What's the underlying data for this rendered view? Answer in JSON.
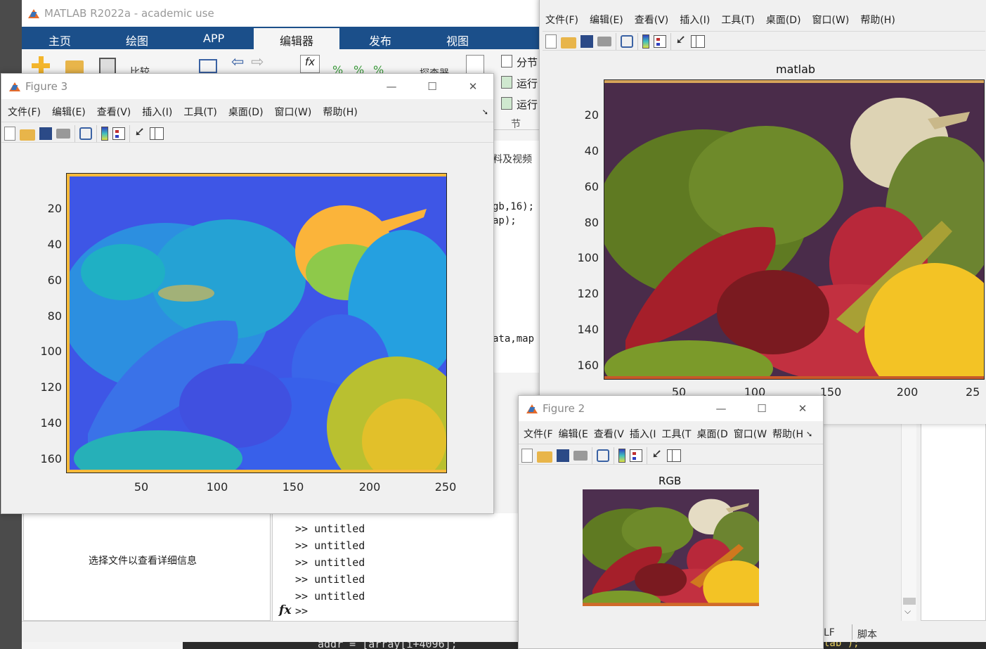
{
  "matlab": {
    "title": "MATLAB R2022a - academic use",
    "tabs": [
      "主页",
      "绘图",
      "APP",
      "编辑器",
      "发布",
      "视图"
    ],
    "active_tab": "编辑器",
    "ribbon_right": [
      "分节",
      "运行",
      "运行"
    ],
    "ribbon_section": "节",
    "ribbon_partial_1": "比较",
    "ribbon_partial_2": "探查器",
    "code_fragments": [
      "料及视频",
      "gb,16);",
      "ap);",
      "ata,map"
    ],
    "detail_panel_text": "选择文件以查看详细信息",
    "command_history": [
      ">> untitled",
      ">> untitled",
      ">> untitled",
      ">> untitled",
      ">> untitled"
    ],
    "prompt": ">>",
    "fx": "fx",
    "bottom_code": "addr = [array[i+4096];",
    "bottom_code_right": "lab\");",
    "status_lf": "LF",
    "status_script": "脚本"
  },
  "menu_full": [
    "文件(F)",
    "编辑(E)",
    "查看(V)",
    "插入(I)",
    "工具(T)",
    "桌面(D)",
    "窗口(W)",
    "帮助(H)"
  ],
  "menu_truncated": [
    "文件(F",
    "编辑(E",
    "查看(V",
    "插入(I",
    "工具(T",
    "桌面(D",
    "窗口(W",
    "帮助(H"
  ],
  "figure3": {
    "title": "Figure 3",
    "yticks": [
      "20",
      "40",
      "60",
      "80",
      "100",
      "120",
      "140",
      "160"
    ],
    "xticks": [
      "50",
      "100",
      "150",
      "200",
      "250"
    ]
  },
  "figure1": {
    "plot_title": "matlab",
    "yticks": [
      "20",
      "40",
      "60",
      "80",
      "100",
      "120",
      "140",
      "160"
    ],
    "xticks": [
      "50",
      "100",
      "150",
      "200",
      "25"
    ]
  },
  "figure2": {
    "title": "Figure 2",
    "plot_title": "RGB"
  },
  "colors": {
    "matlab_tab_bar": "#1b4f8a",
    "active_tab": "#f5f5f5",
    "parula_blue": "#3e56e6",
    "parula_yellow": "#f7ba3a"
  }
}
